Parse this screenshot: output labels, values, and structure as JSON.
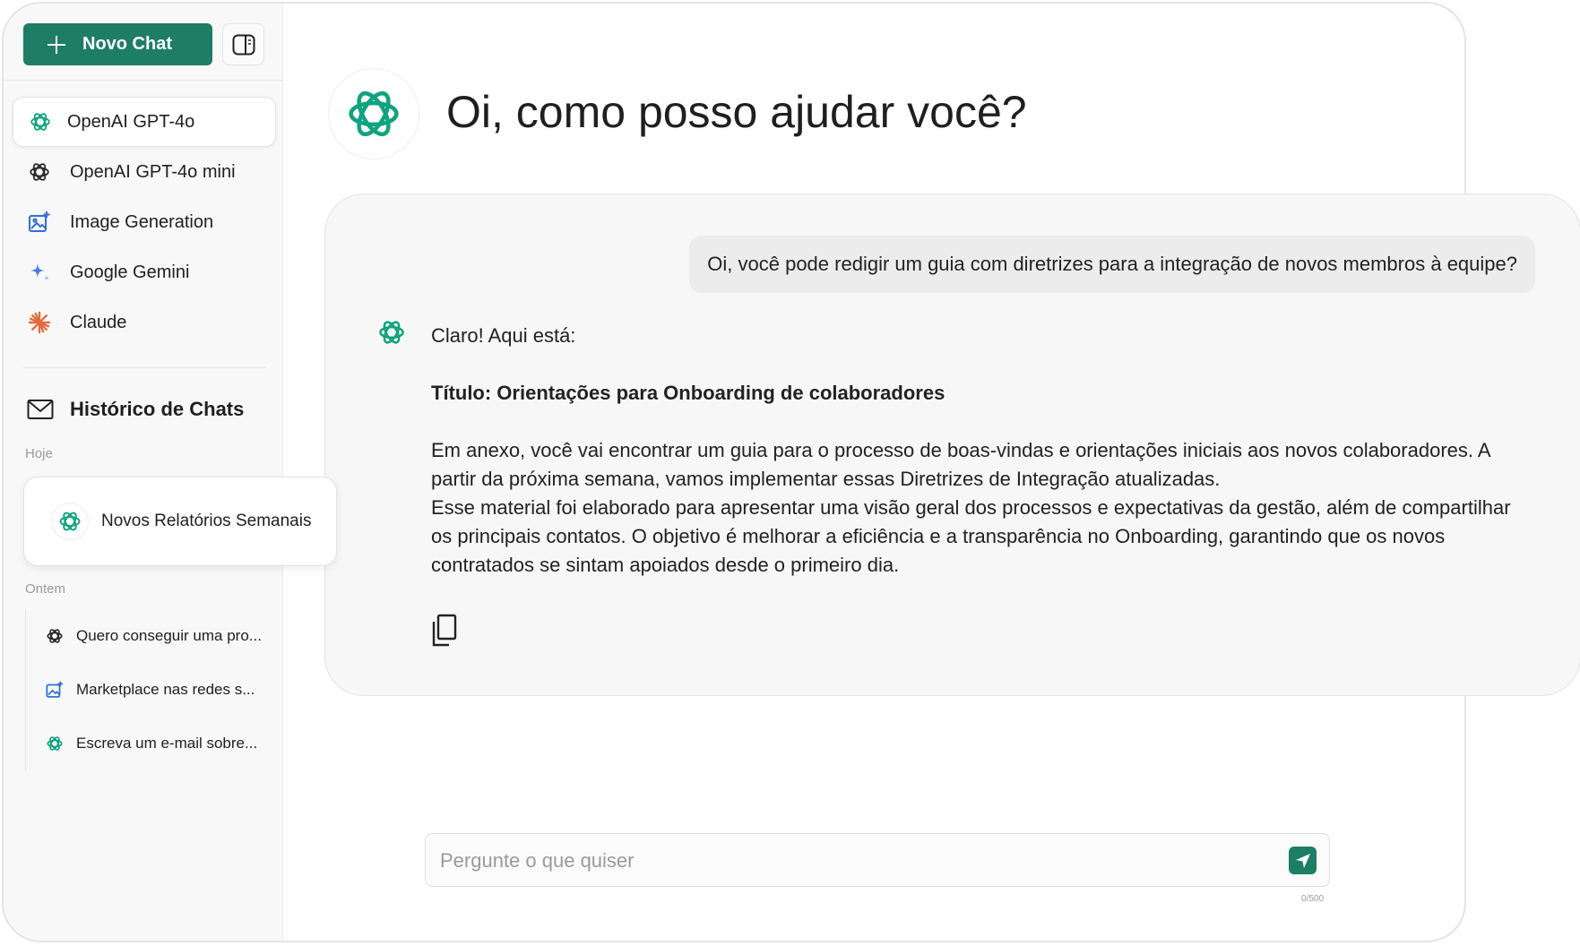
{
  "sidebar": {
    "new_chat_label": "Novo Chat",
    "models": [
      {
        "label": "OpenAI GPT-4o",
        "icon": "openai-icon",
        "active": true
      },
      {
        "label": "OpenAI GPT-4o mini",
        "icon": "openai-icon"
      },
      {
        "label": "Image Generation",
        "icon": "image-generation-icon"
      },
      {
        "label": "Google Gemini",
        "icon": "gemini-icon"
      },
      {
        "label": "Claude",
        "icon": "claude-icon"
      }
    ],
    "history_title": "Histórico de Chats",
    "today_label": "Hoje",
    "today_items": [
      {
        "label": "Novos Relatórios Semanais",
        "icon": "openai-icon"
      }
    ],
    "yesterday_label": "Ontem",
    "yesterday_items": [
      {
        "label": "Quero conseguir uma pro...",
        "icon": "openai-icon"
      },
      {
        "label": "Marketplace nas redes s...",
        "icon": "image-generation-icon"
      },
      {
        "label": "Escreva um e-mail sobre...",
        "icon": "openai-icon"
      }
    ]
  },
  "main": {
    "heading": "Oi, como posso ajudar você?",
    "user_message": "Oi, você pode redigir um guia com diretrizes para a integração de novos membros à equipe?",
    "assistant": {
      "intro": "Claro! Aqui está:",
      "title": "Título: Orientações para Onboarding de colaboradores",
      "paragraph_1": "Em anexo, você vai encontrar um guia para o processo de boas-vindas e orientações iniciais aos novos colaboradores. A partir da próxima semana, vamos implementar essas Diretrizes de Integração atualizadas.",
      "paragraph_2": "Esse material foi elaborado para apresentar uma visão geral dos processos e expectativas da gestão, além de compartilhar os principais contatos. O objetivo é melhorar a eficiência e a transparência no Onboarding, garantindo que os novos contratados se sintam apoiados desde o primeiro dia."
    },
    "input": {
      "placeholder": "Pergunte o que quiser",
      "value": "",
      "counter": "0/500"
    }
  },
  "colors": {
    "accent": "#1e7d65",
    "openai_green": "#10a37f",
    "image_gen_blue": "#2f6fd6",
    "claude_orange": "#e36b3f",
    "gemini_blue": "#4a7fe8"
  }
}
